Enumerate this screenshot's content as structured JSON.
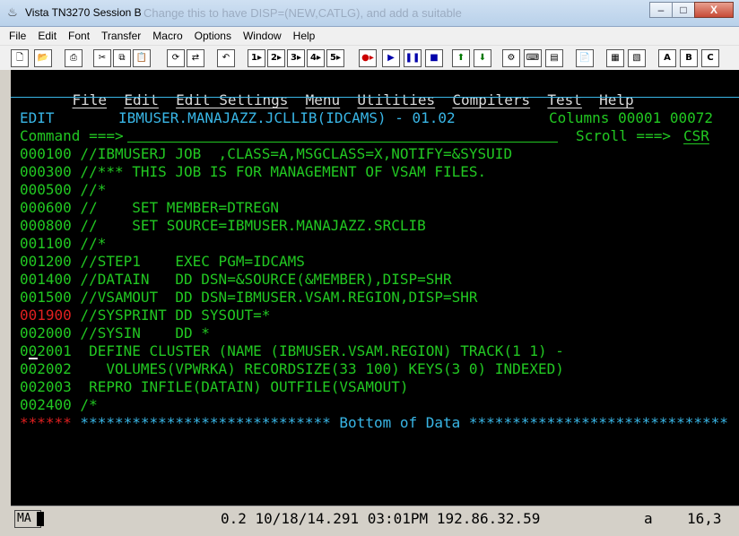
{
  "window": {
    "title": "Vista TN3270 Session B",
    "overlay_text": "Change this to have DISP=(NEW,CATLG), and add a suitable",
    "buttons": [
      "–",
      "□",
      "X"
    ]
  },
  "menubar": [
    "File",
    "Edit",
    "Font",
    "Transfer",
    "Macro",
    "Options",
    "Window",
    "Help"
  ],
  "toolbar": {
    "play_labels": [
      "1",
      "2",
      "3",
      "4",
      "5"
    ],
    "letter_labels": [
      "A",
      "B",
      "C"
    ]
  },
  "ispf": {
    "menu": [
      "File",
      "Edit",
      "Edit_Settings",
      "Menu",
      "Utilities",
      "Compilers",
      "Test",
      "Help"
    ],
    "header_mode": "EDIT",
    "dataset": "IBMUSER.MANAJAZZ.JCLLIB(IDCAMS) - 01.02",
    "columns_text": "Columns 00001 00072",
    "command_prompt": "Command ===>",
    "scroll_label": "Scroll ===>",
    "scroll_value": "CSR"
  },
  "lines": [
    {
      "num": "000100",
      "text": " //IBMUSERJ JOB  ,CLASS=A,MSGCLASS=X,NOTIFY=&SYSUID"
    },
    {
      "num": "000300",
      "text": " //*** THIS JOB IS FOR MANAGEMENT OF VSAM FILES."
    },
    {
      "num": "000500",
      "text": " //*"
    },
    {
      "num": "000600",
      "text": " //    SET MEMBER=DTREGN"
    },
    {
      "num": "000800",
      "text": " //    SET SOURCE=IBMUSER.MANAJAZZ.SRCLIB"
    },
    {
      "num": "001100",
      "text": " //*"
    },
    {
      "num": "001200",
      "text": " //STEP1    EXEC PGM=IDCAMS"
    },
    {
      "num": "001400",
      "text": " //DATAIN   DD DSN=&SOURCE(&MEMBER),DISP=SHR"
    },
    {
      "num": "001500",
      "text": " //VSAMOUT  DD DSN=IBMUSER.VSAM.REGION,DISP=SHR"
    },
    {
      "num": "001900",
      "text": " //SYSPRINT DD SYSOUT=*"
    },
    {
      "num": "002000",
      "text": " //SYSIN    DD *"
    },
    {
      "num": "002001",
      "text": "  DEFINE CLUSTER (NAME (IBMUSER.VSAM.REGION) TRACK(1 1) -"
    },
    {
      "num": "002002",
      "text": "    VOLUMES(VPWRKA) RECORDSIZE(33 100) KEYS(3 0) INDEXED)"
    },
    {
      "num": "002003",
      "text": "  REPRO INFILE(DATAIN) OUTFILE(VSAMOUT)"
    },
    {
      "num": "002400",
      "text": " /*"
    }
  ],
  "bottom": {
    "marker": "******",
    "text": " ***************************** Bottom of Data ******************************"
  },
  "status": {
    "mode": "MA",
    "info": "0.2 10/18/14.291 03:01PM 192.86.32.59",
    "field": "a",
    "cursor_pos": "16,3"
  }
}
